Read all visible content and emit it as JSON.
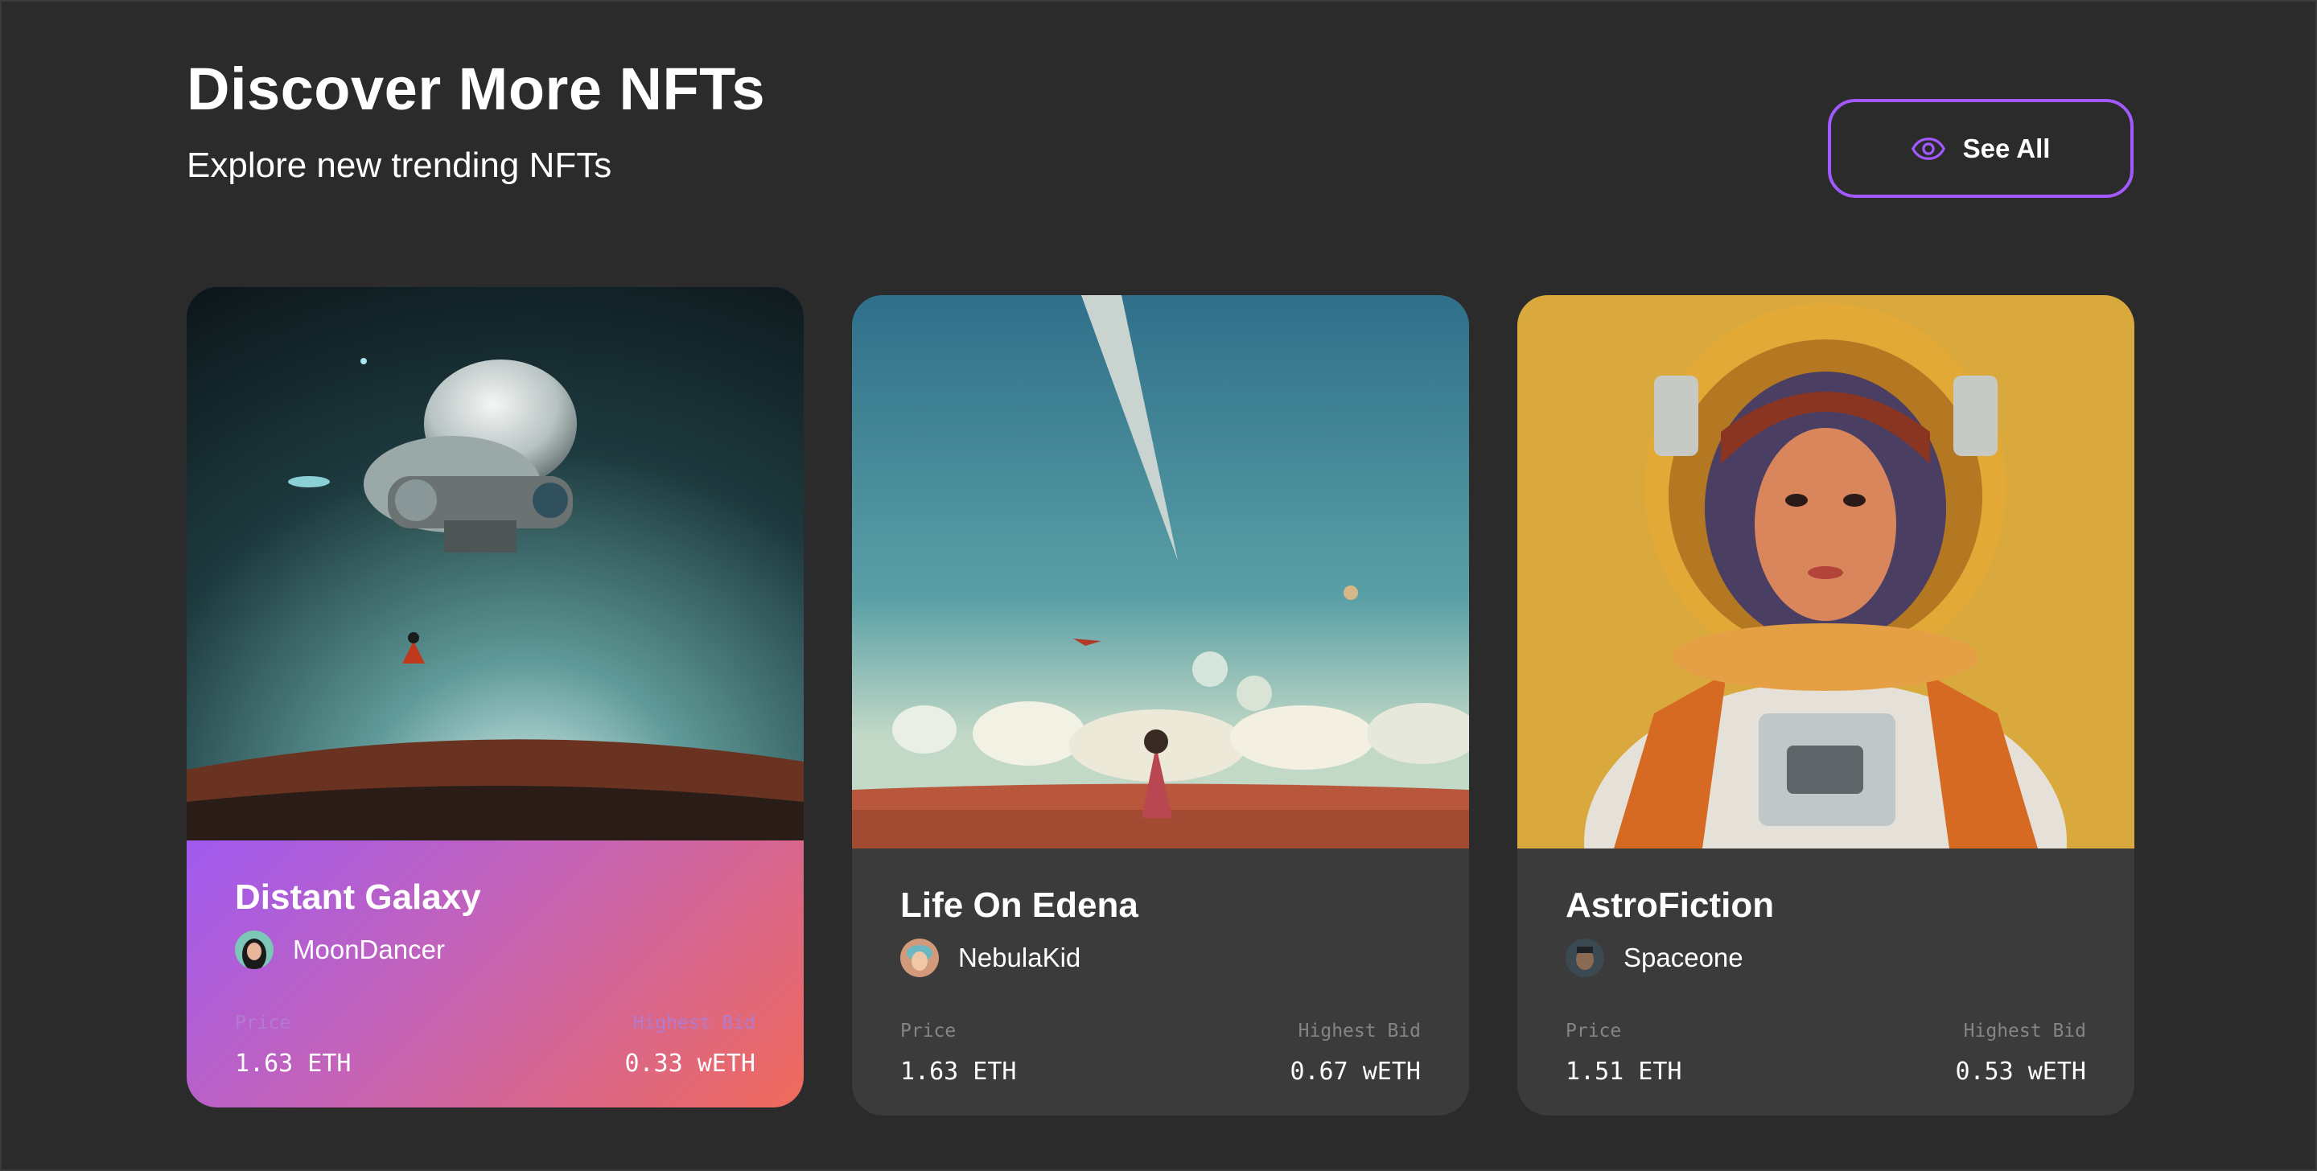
{
  "header": {
    "title": "Discover More NFTs",
    "subtitle": "Explore new trending NFTs"
  },
  "see_all": {
    "label": "See All",
    "icon": "eye-icon"
  },
  "colors": {
    "accent": "#a259ff",
    "background": "#2b2b2b",
    "card": "#3b3b3b",
    "label": "#858584"
  },
  "cards": [
    {
      "name": "Distant Galaxy",
      "artist": "MoonDancer",
      "price_label": "Price",
      "price": "1.63 ETH",
      "bid_label": "Highest Bid",
      "bid": "0.33 wETH"
    },
    {
      "name": "Life On Edena",
      "artist": "NebulaKid",
      "price_label": "Price",
      "price": "1.63 ETH",
      "bid_label": "Highest Bid",
      "bid": "0.67 wETH"
    },
    {
      "name": "AstroFiction",
      "artist": "Spaceone",
      "price_label": "Price",
      "price": "1.51 ETH",
      "bid_label": "Highest Bid",
      "bid": "0.53 wETH"
    }
  ]
}
